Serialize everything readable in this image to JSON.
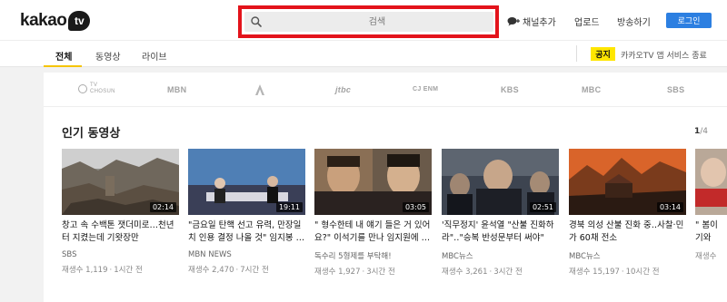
{
  "header": {
    "logo_text": "kakao",
    "logo_badge": "tv",
    "search_placeholder": "검색",
    "channel_add": "채널추가",
    "upload": "업로드",
    "broadcast": "방송하기",
    "login": "로그인"
  },
  "tabs": {
    "items": [
      {
        "label": "전체",
        "active": true
      },
      {
        "label": "동영상",
        "active": false
      },
      {
        "label": "라이브",
        "active": false
      }
    ],
    "notice_badge": "공지",
    "notice_text": "카카오TV 앱 서비스 종료"
  },
  "broadcasters": {
    "tvchosun_top": "TV",
    "tvchosun_bottom": "CHOSUN",
    "mbn": "MBN",
    "jtbc": "jtbc",
    "cjenm": "CJ ENM",
    "kbs": "KBS",
    "mbc": "MBC",
    "sbs": "SBS"
  },
  "popular": {
    "title": "인기 동영상",
    "page_current": "1",
    "page_total": "/4"
  },
  "videos": [
    {
      "duration": "02:14",
      "title": "창고 속 수백톤 잿더미로…천년 터 지켰는데 기왓장만",
      "channel": "SBS",
      "views": "재생수 1,119",
      "time": "1시간 전"
    },
    {
      "duration": "19:11",
      "title": "\"금요일 탄핵 선고 유력, 만장일치 인용 결정 나올 것\" 임지봉 …",
      "channel": "MBN NEWS",
      "views": "재생수 2,470",
      "time": "7시간 전"
    },
    {
      "duration": "03:05",
      "title": "\" 형수한테 내 얘기 들은 거 있어요?\" 이석기를 만나 임지원에 …",
      "channel": "독수리 5형제를 부탁해!",
      "views": "재생수 1,927",
      "time": "3시간 전"
    },
    {
      "duration": "02:51",
      "title": "'직무정지' 윤석열 \"산불 진화하라\"‥\"승복 반성문부터 써야\"",
      "channel": "MBC뉴스",
      "views": "재생수 3,261",
      "time": "3시간 전"
    },
    {
      "duration": "03:14",
      "title": "경북 의성 산불 진화 중‥사찰·민가 60채 전소",
      "channel": "MBC뉴스",
      "views": "재생수 15,197",
      "time": "10시간 전"
    },
    {
      "duration": "",
      "title": "\" 봄이 기와 김…",
      "channel": "",
      "views": "재생수",
      "time": ""
    }
  ]
}
